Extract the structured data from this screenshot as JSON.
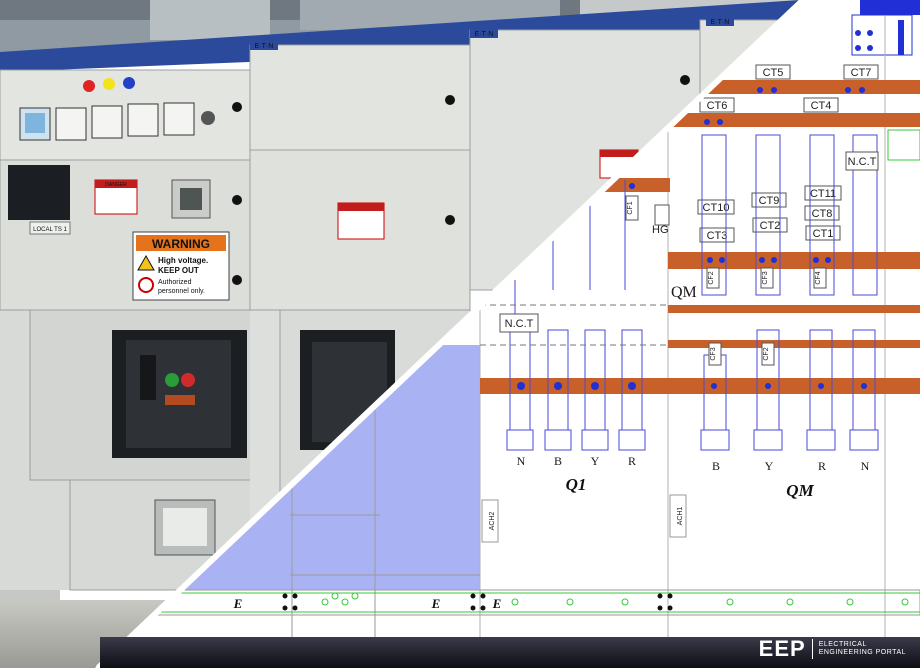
{
  "photo": {
    "brand_badges": [
      "E·T·N",
      "E·T·N",
      "E·T·N"
    ],
    "panel_label": "LOCAL TS 1",
    "warning_sign": {
      "title": "WARNING",
      "line1": "High voltage.",
      "line2": "KEEP OUT",
      "line3": "Authorized",
      "line4": "personnel only."
    },
    "danger_label": "DANGER"
  },
  "diagram": {
    "current_transformers": [
      "CT5",
      "CT7",
      "CT6",
      "CT4",
      "CT10",
      "CT9",
      "CT11",
      "CT8",
      "CT3",
      "CT2",
      "CT1"
    ],
    "nct_labels": [
      "N.C.T",
      "N.C.T"
    ],
    "hg_label": "HG",
    "qm_side_label": "QM",
    "cf_labels": [
      "CF1",
      "CF2",
      "CF3",
      "CF4",
      "CF3",
      "CF2"
    ],
    "phases_q1": [
      "N",
      "B",
      "Y",
      "R"
    ],
    "phases_qm": [
      "B",
      "Y",
      "R",
      "N"
    ],
    "section_q1": "Q1",
    "section_qm": "QM",
    "ach_labels": [
      "ACH2",
      "ACH1"
    ],
    "earth_labels": [
      "E",
      "E",
      "E"
    ]
  },
  "logo": {
    "mark": "EEP",
    "sub_line1": "ELECTRICAL",
    "sub_line2": "ENGINEERING PORTAL"
  },
  "colors": {
    "busbar": "#c8602a",
    "wire": "#4a4ad8",
    "diagram_bg": "#ffffff",
    "panel_grey": "#d9dcd8",
    "accent_blue": "#1726c9",
    "earth_green": "#37c83a"
  }
}
